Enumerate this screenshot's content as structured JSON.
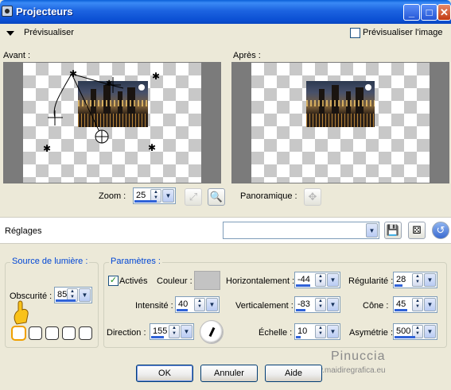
{
  "window": {
    "title": "Projecteurs"
  },
  "preview": {
    "label": "Prévisualiser",
    "checkbox_label": "Prévisualiser l'image",
    "checkbox_checked": false
  },
  "before": {
    "label": "Avant :"
  },
  "after": {
    "label": "Après :"
  },
  "zoom": {
    "label": "Zoom :",
    "value": "25"
  },
  "pan": {
    "label": "Panoramique :"
  },
  "presets": {
    "label": "Réglages",
    "value": ""
  },
  "light_source": {
    "legend": "Source de lumière :",
    "darkness_label": "Obscurité :",
    "darkness_value": "85"
  },
  "params": {
    "legend": "Paramètres :",
    "active_label": "Activés",
    "active_checked": true,
    "color_label": "Couleur :",
    "color_value": "#c3c3c3",
    "intensity_label": "Intensité :",
    "intensity_value": "40",
    "direction_label": "Direction :",
    "direction_value": "155",
    "horizontal_label": "Horizontalement :",
    "horizontal_value": "-44",
    "vertical_label": "Verticalement :",
    "vertical_value": "-83",
    "scale_label": "Échelle :",
    "scale_value": "10",
    "regularity_label": "Régularité :",
    "regularity_value": "28",
    "cone_label": "Cône :",
    "cone_value": "45",
    "asymmetry_label": "Asymétrie :",
    "asymmetry_value": "500"
  },
  "buttons": {
    "ok": "OK",
    "cancel": "Annuler",
    "help": "Aide"
  },
  "watermark": {
    "name": "Pinuccia",
    "url": "www.maidiregrafica.eu"
  }
}
